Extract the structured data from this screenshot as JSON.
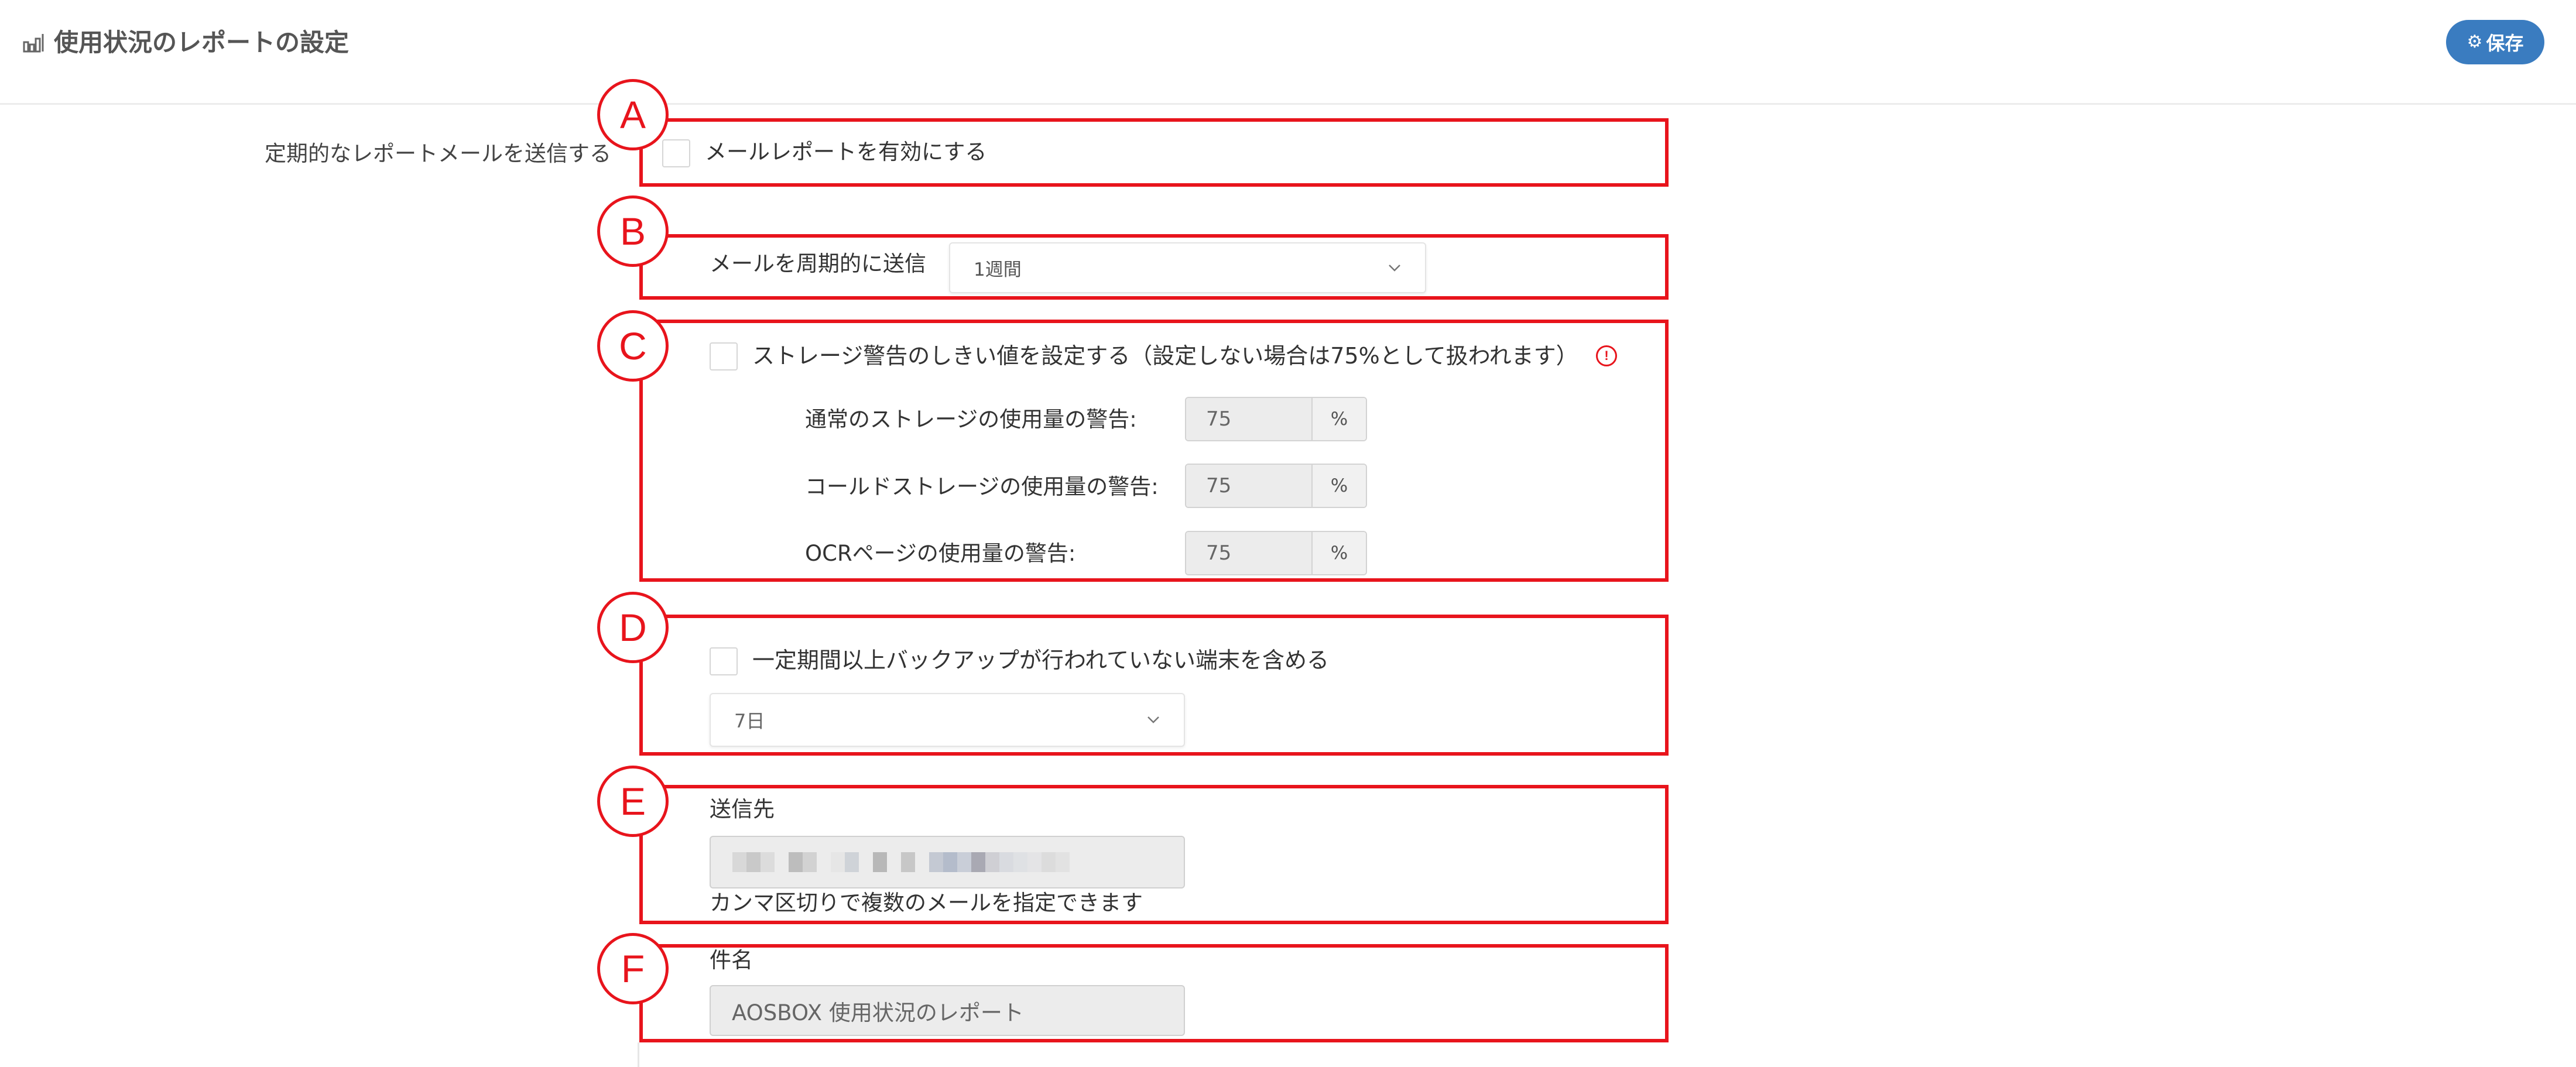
{
  "header": {
    "icon": "bar-chart-icon",
    "title": "使用状況のレポートの設定",
    "save_button": {
      "icon": "gear-icon",
      "label": "保存"
    }
  },
  "colors": {
    "accent": "#3a7cc0",
    "annotation": "#e8141c"
  },
  "annotation_markers": [
    "A",
    "B",
    "C",
    "D",
    "E",
    "F"
  ],
  "report_mail": {
    "section_label": "定期的なレポートメールを送信する",
    "enable_label": "メールレポートを有効にする",
    "enabled": false
  },
  "interval": {
    "label": "メールを周期的に送信",
    "selected": "1週間",
    "chevron_icon": "chevron-down-icon"
  },
  "storage_warning": {
    "label": "ストレージ警告のしきい値を設定する（設定しない場合は75%として扱われます）",
    "enabled": false,
    "info_icon": "info-icon",
    "thresholds": [
      {
        "label": "通常のストレージの使用量の警告:",
        "value": "75",
        "unit": "%"
      },
      {
        "label": "コールドストレージの使用量の警告:",
        "value": "75",
        "unit": "%"
      },
      {
        "label": "OCRページの使用量の警告:",
        "value": "75",
        "unit": "%"
      }
    ]
  },
  "inactive_devices": {
    "label": "一定期間以上バックアップが行われていない端末を含める",
    "enabled": false,
    "period_selected": "7日"
  },
  "recipients": {
    "label": "送信先",
    "help": "カンマ区切りで複数のメールを指定できます"
  },
  "subject": {
    "label": "件名",
    "value": "AOSBOX 使用状況のレポート"
  }
}
